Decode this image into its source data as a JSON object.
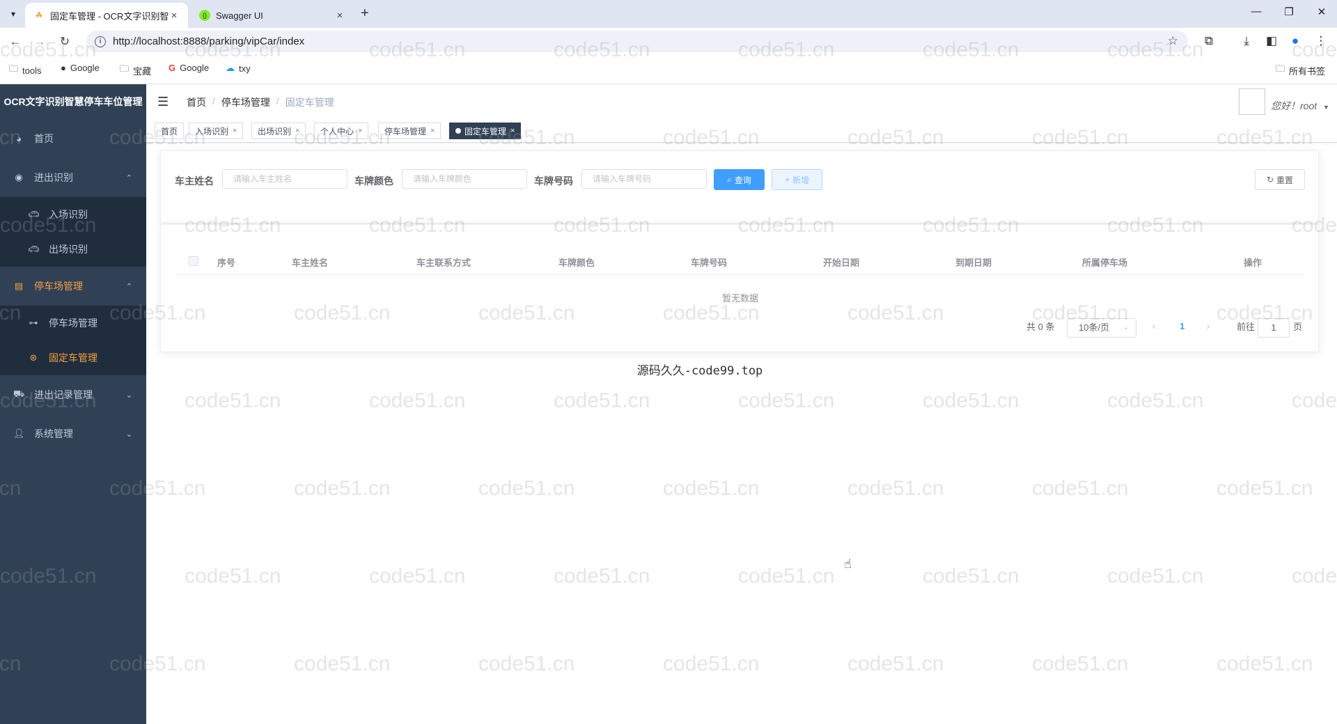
{
  "browser": {
    "tabs": [
      {
        "title": "固定车管理 - OCR文字识别智慧",
        "active": true,
        "close": "×"
      },
      {
        "title": "Swagger UI",
        "active": false,
        "close": "×"
      }
    ],
    "new_tab": "+",
    "url": "http://localhost:8888/parking/vipCar/index",
    "bookmarks": [
      {
        "label": "tools",
        "icon": "folder-icon"
      },
      {
        "label": "Google",
        "icon": "github-icon"
      },
      {
        "label": "宝藏",
        "icon": "folder-icon"
      },
      {
        "label": "Google",
        "icon": "google-icon"
      },
      {
        "label": "txy",
        "icon": "cloud-icon"
      }
    ],
    "all_bookmarks": "所有书签"
  },
  "sidebar": {
    "title": "OCR文字识别智慧停车车位管理",
    "items": [
      {
        "label": "首页",
        "icon": "dashboard-icon"
      },
      {
        "label": "进出识别",
        "icon": "eye-icon",
        "chevron": "⌃"
      },
      {
        "label": "入场识别",
        "icon": "car-icon"
      },
      {
        "label": "出场识别",
        "icon": "car-icon"
      },
      {
        "label": "停车场管理",
        "icon": "document-icon",
        "chevron": "⌃"
      },
      {
        "label": "停车场管理",
        "icon": "tree-icon"
      },
      {
        "label": "固定车管理",
        "icon": "star-icon"
      },
      {
        "label": "进出记录管理",
        "icon": "truck-icon",
        "chevron": "⌄"
      },
      {
        "label": "系统管理",
        "icon": "user-icon",
        "chevron": "⌄"
      }
    ]
  },
  "navbar": {
    "breadcrumb": [
      "首页",
      "停车场管理",
      "固定车管理"
    ],
    "breadcrumb_sep": "/",
    "greeting": "您好！root"
  },
  "tags": [
    {
      "label": "首页"
    },
    {
      "label": "入场识别",
      "close": "×"
    },
    {
      "label": "出场识别",
      "close": "×"
    },
    {
      "label": "个人中心",
      "close": "×"
    },
    {
      "label": "停车场管理",
      "close": "×"
    },
    {
      "label": "固定车管理",
      "close": "×",
      "active": true
    }
  ],
  "search": {
    "owner_label": "车主姓名",
    "owner_placeholder": "请输入车主姓名",
    "color_label": "车牌颜色",
    "color_placeholder": "请输入车牌颜色",
    "plate_label": "车牌号码",
    "plate_placeholder": "请输入车牌号码",
    "query_btn": "查询",
    "add_btn": "新增",
    "reset_btn": "重置"
  },
  "table": {
    "columns": [
      "序号",
      "车主姓名",
      "车主联系方式",
      "车牌颜色",
      "车牌号码",
      "开始日期",
      "到期日期",
      "所属停车场",
      "操作"
    ],
    "empty_text": "暂无数据"
  },
  "pagination": {
    "total": "共 0 条",
    "page_size": "10条/页",
    "current_page": "1",
    "goto_label": "前往",
    "goto_value": "1",
    "page_unit": "页"
  },
  "footer": "源码久久-code99.top",
  "watermark": "code51.cn",
  "colors": {
    "sidebar_bg": "#304156",
    "active_menu": "#f4a041",
    "primary": "#409eff"
  }
}
